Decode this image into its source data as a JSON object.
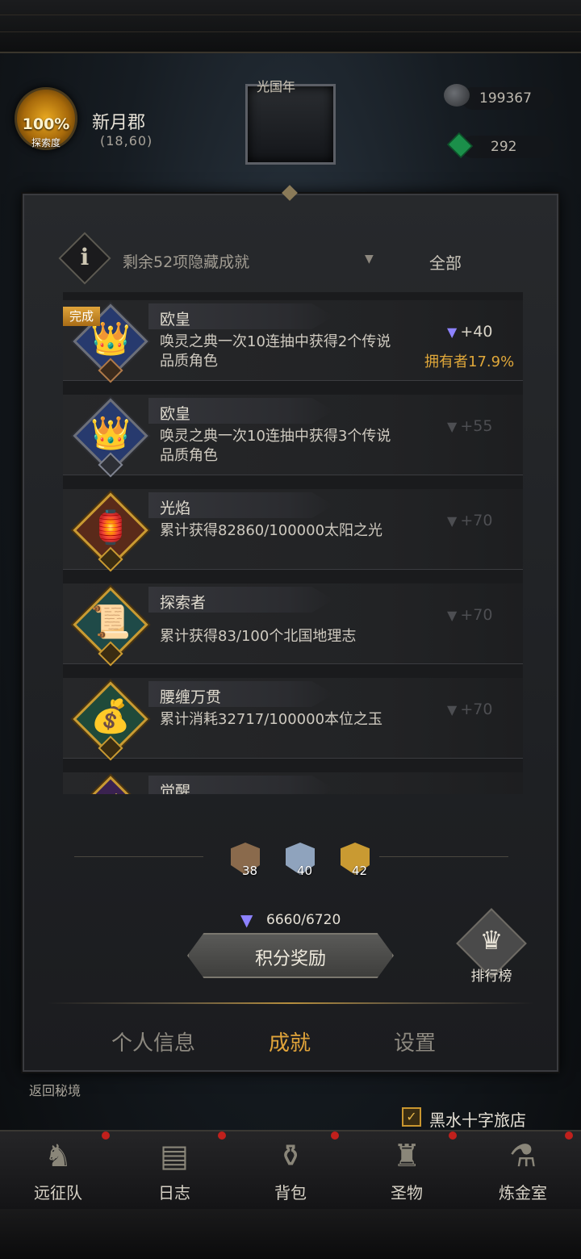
{
  "header": {
    "explore_pct": "100%",
    "explore_label": "探索度",
    "location_name": "新月郡",
    "location_coord": "(18,60)",
    "portrait_title": "光国年",
    "resource_stone": "199367",
    "resource_gem": "292"
  },
  "panel": {
    "info_glyph": "i",
    "hidden_count": "剩余52项隐藏成就",
    "filter": "全部"
  },
  "achievements": [
    {
      "name": "欧皇",
      "desc": "唤灵之典一次10连抽中获得2个传说品质角色",
      "reward": "+40",
      "owner": "拥有者17.9%",
      "done_tag": "完成",
      "badge_glyph": "👑"
    },
    {
      "name": "欧皇",
      "desc": "唤灵之典一次10连抽中获得3个传说品质角色",
      "reward": "+55",
      "badge_glyph": "👑"
    },
    {
      "name": "光焰",
      "desc": "累计获得82860/100000太阳之光",
      "reward": "+70",
      "badge_glyph": "🏮"
    },
    {
      "name": "探索者",
      "desc": "累计获得83/100个北国地理志",
      "reward": "+70",
      "badge_glyph": "📜"
    },
    {
      "name": "腰缠万贯",
      "desc": "累计消耗32717/100000本位之玉",
      "reward": "+70",
      "badge_glyph": "💰"
    },
    {
      "name": "觉醒",
      "desc": "",
      "reward": "",
      "badge_glyph": "✨"
    }
  ],
  "tiers": [
    {
      "count": "38",
      "color": "#8a6a4c"
    },
    {
      "count": "40",
      "color": "#8fa3bd"
    },
    {
      "count": "42",
      "color": "#c99a32"
    }
  ],
  "score": "6660/6720",
  "reward_button": "积分奖励",
  "rank_label": "排行榜",
  "tabs": [
    "个人信息",
    "成就",
    "设置"
  ],
  "return_link": "返回秘境",
  "inn": "黑水十字旅店",
  "nav": [
    "远征队",
    "日志",
    "背包",
    "圣物",
    "炼金室"
  ],
  "colors": {
    "accent": "#e1a43a",
    "points": "#8d82ff"
  }
}
